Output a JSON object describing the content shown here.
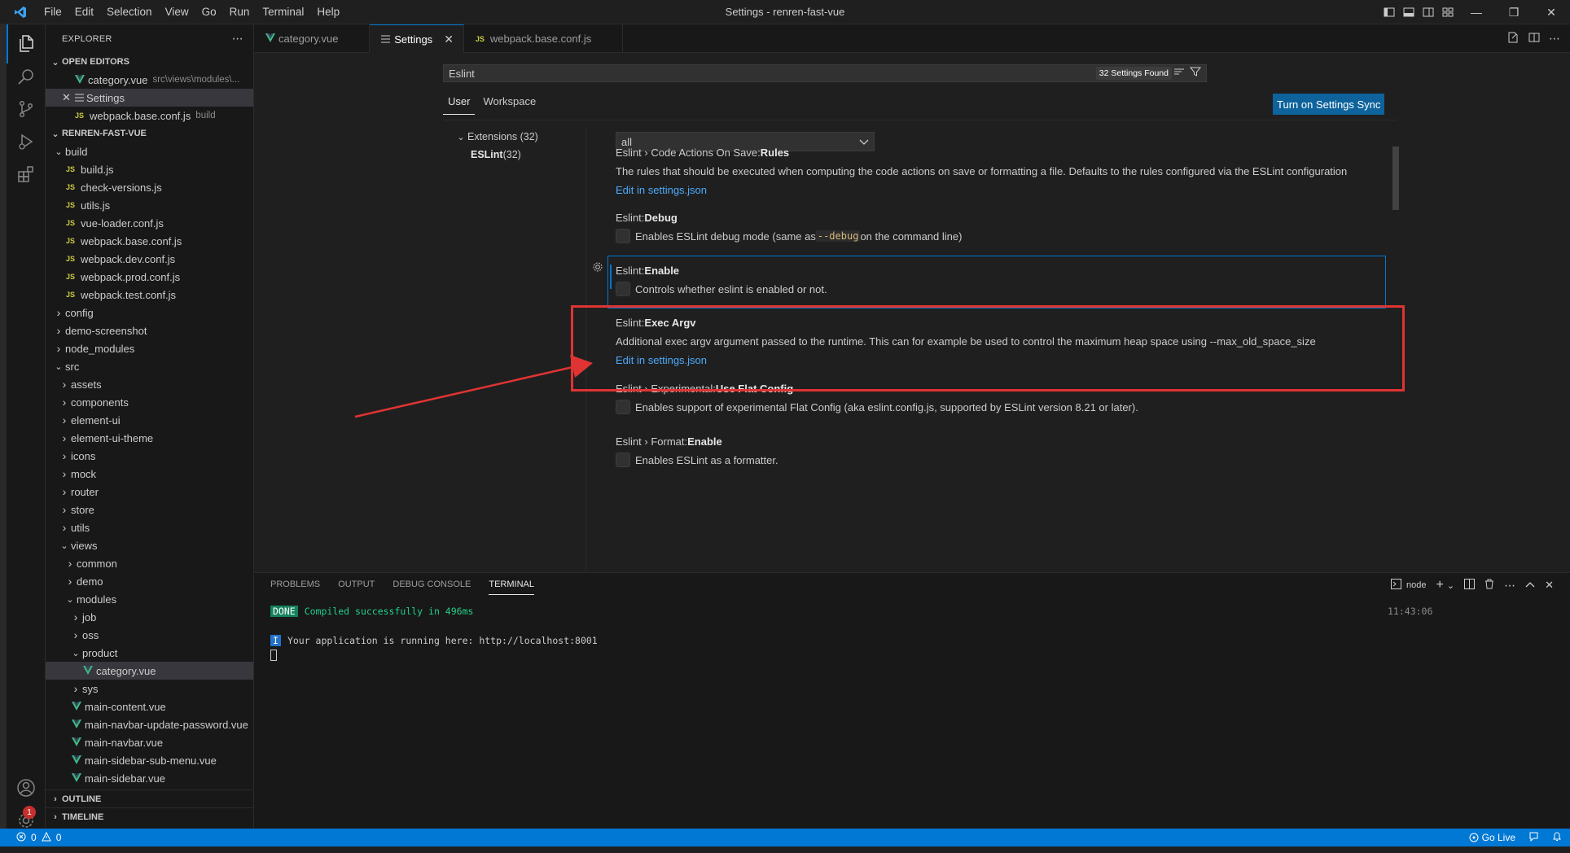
{
  "window": {
    "title": "Settings - renren-fast-vue"
  },
  "menu": [
    "File",
    "Edit",
    "Selection",
    "View",
    "Go",
    "Run",
    "Terminal",
    "Help"
  ],
  "explorer": {
    "header": "EXPLORER",
    "open_editors_title": "OPEN EDITORS",
    "open_editors": [
      {
        "name": "category.vue",
        "desc": "src\\views\\modules\\..."
      },
      {
        "name": "Settings",
        "desc": ""
      },
      {
        "name": "webpack.base.conf.js",
        "desc": "build"
      }
    ],
    "project_title": "RENREN-FAST-VUE",
    "tree": [
      {
        "label": "build",
        "kind": "folder-open",
        "depth": 1
      },
      {
        "label": "build.js",
        "kind": "js",
        "depth": 2
      },
      {
        "label": "check-versions.js",
        "kind": "js",
        "depth": 2
      },
      {
        "label": "utils.js",
        "kind": "js",
        "depth": 2
      },
      {
        "label": "vue-loader.conf.js",
        "kind": "js",
        "depth": 2
      },
      {
        "label": "webpack.base.conf.js",
        "kind": "js",
        "depth": 2
      },
      {
        "label": "webpack.dev.conf.js",
        "kind": "js",
        "depth": 2
      },
      {
        "label": "webpack.prod.conf.js",
        "kind": "js",
        "depth": 2
      },
      {
        "label": "webpack.test.conf.js",
        "kind": "js",
        "depth": 2
      },
      {
        "label": "config",
        "kind": "folder",
        "depth": 1
      },
      {
        "label": "demo-screenshot",
        "kind": "folder",
        "depth": 1
      },
      {
        "label": "node_modules",
        "kind": "folder",
        "depth": 1
      },
      {
        "label": "src",
        "kind": "folder-open",
        "depth": 1
      },
      {
        "label": "assets",
        "kind": "folder",
        "depth": 2
      },
      {
        "label": "components",
        "kind": "folder",
        "depth": 2
      },
      {
        "label": "element-ui",
        "kind": "folder",
        "depth": 2
      },
      {
        "label": "element-ui-theme",
        "kind": "folder",
        "depth": 2
      },
      {
        "label": "icons",
        "kind": "folder",
        "depth": 2
      },
      {
        "label": "mock",
        "kind": "folder",
        "depth": 2
      },
      {
        "label": "router",
        "kind": "folder",
        "depth": 2
      },
      {
        "label": "store",
        "kind": "folder",
        "depth": 2
      },
      {
        "label": "utils",
        "kind": "folder",
        "depth": 2
      },
      {
        "label": "views",
        "kind": "folder-open",
        "depth": 2
      },
      {
        "label": "common",
        "kind": "folder",
        "depth": 3
      },
      {
        "label": "demo",
        "kind": "folder",
        "depth": 3
      },
      {
        "label": "modules",
        "kind": "folder-open",
        "depth": 3
      },
      {
        "label": "job",
        "kind": "folder",
        "depth": 4
      },
      {
        "label": "oss",
        "kind": "folder",
        "depth": 4
      },
      {
        "label": "product",
        "kind": "folder-open",
        "depth": 4
      },
      {
        "label": "category.vue",
        "kind": "vue",
        "depth": 5,
        "selected": true
      },
      {
        "label": "sys",
        "kind": "folder",
        "depth": 4
      },
      {
        "label": "main-content.vue",
        "kind": "vue",
        "depth": 3
      },
      {
        "label": "main-navbar-update-password.vue",
        "kind": "vue",
        "depth": 3
      },
      {
        "label": "main-navbar.vue",
        "kind": "vue",
        "depth": 3
      },
      {
        "label": "main-sidebar-sub-menu.vue",
        "kind": "vue",
        "depth": 3
      },
      {
        "label": "main-sidebar.vue",
        "kind": "vue",
        "depth": 3
      }
    ],
    "outline": "OUTLINE",
    "timeline": "TIMELINE"
  },
  "tabs": [
    {
      "label": "category.vue",
      "icon": "vue"
    },
    {
      "label": "Settings",
      "icon": "settings",
      "active": true
    },
    {
      "label": "webpack.base.conf.js",
      "icon": "js"
    }
  ],
  "settings": {
    "search_value": "Eslint",
    "found": "32 Settings Found",
    "scope_user": "User",
    "scope_workspace": "Workspace",
    "sync_button": "Turn on Settings Sync",
    "toc_extensions": "Extensions (32)",
    "toc_eslint": "ESLint",
    "toc_eslint_count": " (32)",
    "dropdown_value": "all",
    "items": [
      {
        "prefix": "Eslint › Code Actions On Save: ",
        "name": "Rules",
        "desc": "The rules that should be executed when computing the code actions on save or formatting a file. Defaults to the rules configured via the ESLint configuration",
        "link": "Edit in settings.json"
      },
      {
        "prefix": "Eslint: ",
        "name": "Debug",
        "desc_pre": "Enables ESLint debug mode (same as ",
        "desc_code": "--debug",
        "desc_post": " on the command line)"
      },
      {
        "prefix": "Eslint: ",
        "name": "Enable",
        "desc": "Controls whether eslint is enabled or not."
      },
      {
        "prefix": "Eslint: ",
        "name": "Exec Argv",
        "desc": "Additional exec argv argument passed to the runtime. This can for example be used to control the maximum heap space using --max_old_space_size",
        "link": "Edit in settings.json"
      },
      {
        "prefix": "Eslint › Experimental: ",
        "name": "Use Flat Config",
        "desc": "Enables support of experimental Flat Config (aka eslint.config.js, supported by ESLint version 8.21 or later)."
      },
      {
        "prefix": "Eslint › Format: ",
        "name": "Enable",
        "desc": "Enables ESLint as a formatter."
      }
    ]
  },
  "panel": {
    "tabs": [
      "PROBLEMS",
      "OUTPUT",
      "DEBUG CONSOLE",
      "TERMINAL"
    ],
    "terminal_name": "node",
    "done_badge": "DONE",
    "compiled": "Compiled successfully in 496ms",
    "time": "11:43:06",
    "info_badge": "I",
    "running": "Your application is running here: http://localhost:8001"
  },
  "status": {
    "errors": "0",
    "warnings": "0",
    "go_live": "Go Live"
  },
  "accounts_badge": "1",
  "colors": {
    "accent": "#0078d4",
    "annotation": "#e03333",
    "statusbar": "#0078d4"
  }
}
